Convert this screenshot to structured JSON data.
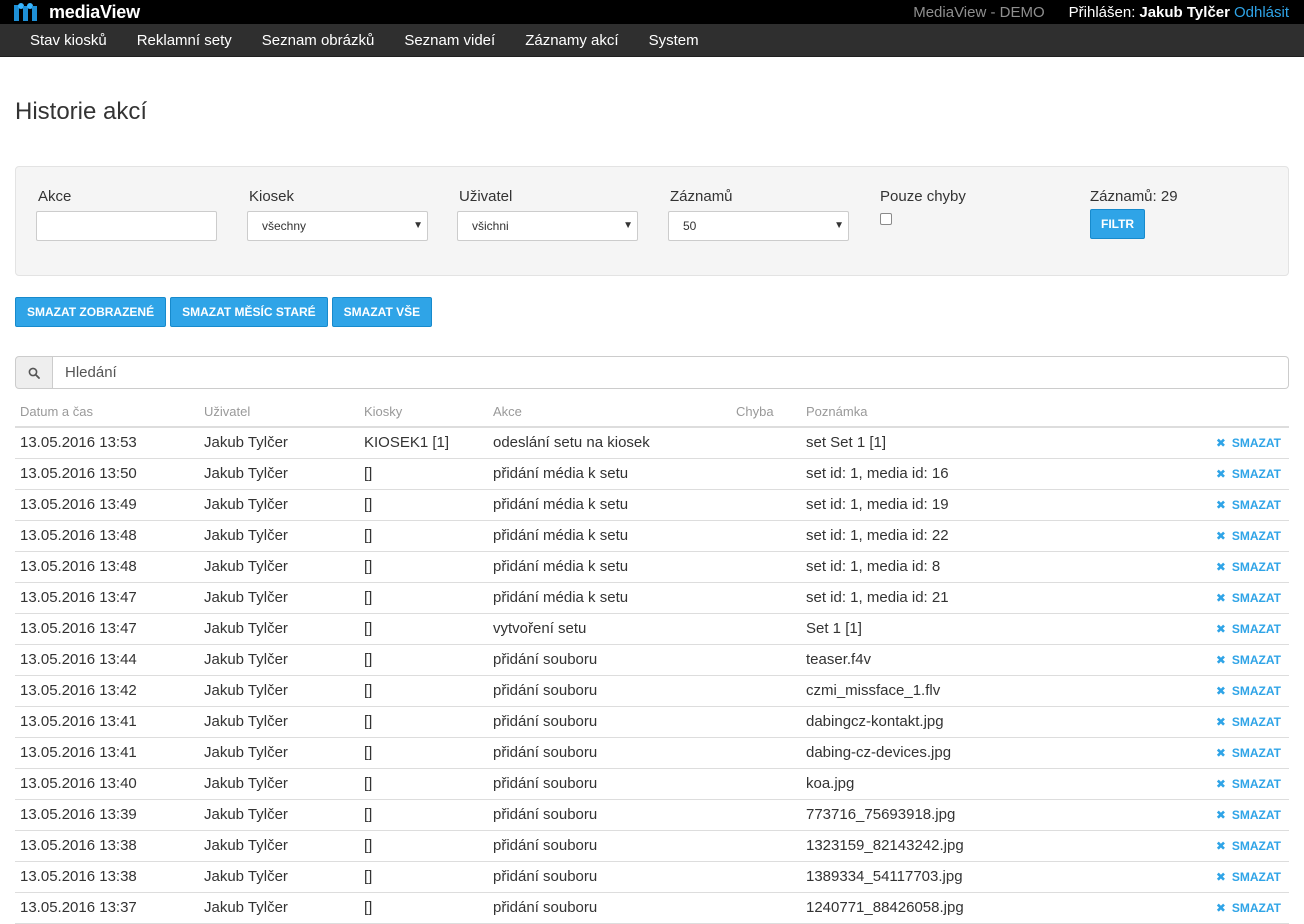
{
  "app": {
    "brand": "mediaView",
    "environment": "MediaView - DEMO",
    "login_prefix": "Přihlášen:",
    "user": "Jakub Tylčer",
    "logout": "Odhlásit",
    "accent_color": "#2fa4e7"
  },
  "nav": {
    "items": [
      {
        "label": "Stav kiosků"
      },
      {
        "label": "Reklamní sety"
      },
      {
        "label": "Seznam obrázků"
      },
      {
        "label": "Seznam videí"
      },
      {
        "label": "Záznamy akcí"
      },
      {
        "label": "System"
      }
    ]
  },
  "page": {
    "title": "Historie akcí"
  },
  "filters": {
    "action_label": "Akce",
    "action_value": "",
    "kiosk_label": "Kiosek",
    "kiosk_value": "všechny",
    "user_label": "Uživatel",
    "user_value": "všichni",
    "records_label": "Záznamů",
    "records_value": "50",
    "errors_only_label": "Pouze chyby",
    "errors_only_checked": false,
    "count_label": "Záznamů: 29",
    "filter_button": "FILTR"
  },
  "actions": {
    "delete_shown": "SMAZAT ZOBRAZENÉ",
    "delete_month_old": "SMAZAT MĚSÍC STARÉ",
    "delete_all": "SMAZAT VŠE"
  },
  "search": {
    "placeholder": "Hledání",
    "icon": "search-icon"
  },
  "table": {
    "headers": [
      "Datum a čas",
      "Uživatel",
      "Kiosky",
      "Akce",
      "Chyba",
      "Poznámka"
    ],
    "delete_label": "SMAZAT",
    "rows": [
      {
        "datetime": "13.05.2016 13:53",
        "user": "Jakub Tylčer",
        "kiosks": "KIOSEK1 [1]",
        "action": "odeslání setu na kiosek",
        "error": "",
        "note": "set Set 1 [1]"
      },
      {
        "datetime": "13.05.2016 13:50",
        "user": "Jakub Tylčer",
        "kiosks": "[]",
        "action": "přidání média k setu",
        "error": "",
        "note": "set id: 1, media id: 16"
      },
      {
        "datetime": "13.05.2016 13:49",
        "user": "Jakub Tylčer",
        "kiosks": "[]",
        "action": "přidání média k setu",
        "error": "",
        "note": "set id: 1, media id: 19"
      },
      {
        "datetime": "13.05.2016 13:48",
        "user": "Jakub Tylčer",
        "kiosks": "[]",
        "action": "přidání média k setu",
        "error": "",
        "note": "set id: 1, media id: 22"
      },
      {
        "datetime": "13.05.2016 13:48",
        "user": "Jakub Tylčer",
        "kiosks": "[]",
        "action": "přidání média k setu",
        "error": "",
        "note": "set id: 1, media id: 8"
      },
      {
        "datetime": "13.05.2016 13:47",
        "user": "Jakub Tylčer",
        "kiosks": "[]",
        "action": "přidání média k setu",
        "error": "",
        "note": "set id: 1, media id: 21"
      },
      {
        "datetime": "13.05.2016 13:47",
        "user": "Jakub Tylčer",
        "kiosks": "[]",
        "action": "vytvoření setu",
        "error": "",
        "note": "Set 1 [1]"
      },
      {
        "datetime": "13.05.2016 13:44",
        "user": "Jakub Tylčer",
        "kiosks": "[]",
        "action": "přidání souboru",
        "error": "",
        "note": "teaser.f4v"
      },
      {
        "datetime": "13.05.2016 13:42",
        "user": "Jakub Tylčer",
        "kiosks": "[]",
        "action": "přidání souboru",
        "error": "",
        "note": "czmi_missface_1.flv"
      },
      {
        "datetime": "13.05.2016 13:41",
        "user": "Jakub Tylčer",
        "kiosks": "[]",
        "action": "přidání souboru",
        "error": "",
        "note": "dabingcz-kontakt.jpg"
      },
      {
        "datetime": "13.05.2016 13:41",
        "user": "Jakub Tylčer",
        "kiosks": "[]",
        "action": "přidání souboru",
        "error": "",
        "note": "dabing-cz-devices.jpg"
      },
      {
        "datetime": "13.05.2016 13:40",
        "user": "Jakub Tylčer",
        "kiosks": "[]",
        "action": "přidání souboru",
        "error": "",
        "note": "koa.jpg"
      },
      {
        "datetime": "13.05.2016 13:39",
        "user": "Jakub Tylčer",
        "kiosks": "[]",
        "action": "přidání souboru",
        "error": "",
        "note": "773716_75693918.jpg"
      },
      {
        "datetime": "13.05.2016 13:38",
        "user": "Jakub Tylčer",
        "kiosks": "[]",
        "action": "přidání souboru",
        "error": "",
        "note": "1323159_82143242.jpg"
      },
      {
        "datetime": "13.05.2016 13:38",
        "user": "Jakub Tylčer",
        "kiosks": "[]",
        "action": "přidání souboru",
        "error": "",
        "note": "1389334_54117703.jpg"
      },
      {
        "datetime": "13.05.2016 13:37",
        "user": "Jakub Tylčer",
        "kiosks": "[]",
        "action": "přidání souboru",
        "error": "",
        "note": "1240771_88426058.jpg"
      }
    ]
  }
}
